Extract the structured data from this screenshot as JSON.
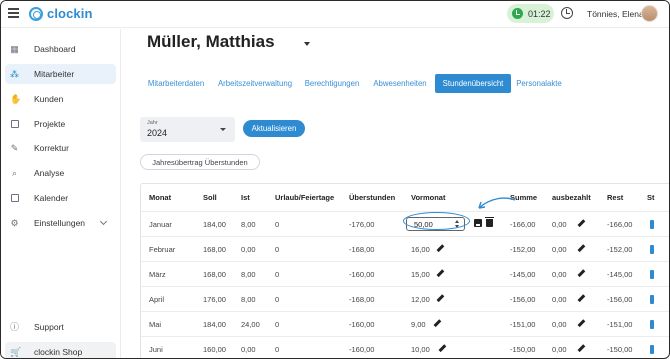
{
  "topbar": {
    "app_name": "clockin",
    "timer": "01:22",
    "user_name": "Tönnies, Elena"
  },
  "sidebar": {
    "items": [
      {
        "label": "Dashboard",
        "icon": "dashboard-icon"
      },
      {
        "label": "Mitarbeiter",
        "icon": "employees-icon",
        "active": true
      },
      {
        "label": "Kunden",
        "icon": "handshake-icon"
      },
      {
        "label": "Projekte",
        "icon": "projects-icon"
      },
      {
        "label": "Korrektur",
        "icon": "correction-icon"
      },
      {
        "label": "Analyse",
        "icon": "analysis-icon"
      },
      {
        "label": "Kalender",
        "icon": "calendar-icon"
      },
      {
        "label": "Einstellungen",
        "icon": "gear-icon"
      }
    ],
    "support_label": "Support",
    "shop_label": "clockin Shop"
  },
  "main": {
    "title": "Müller, Matthias",
    "tabs": [
      {
        "label": "Mitarbeiterdaten"
      },
      {
        "label": "Arbeitszeitverwaltung"
      },
      {
        "label": "Berechtigungen"
      },
      {
        "label": "Abwesenheiten"
      },
      {
        "label": "Stundenübersicht",
        "active": true
      },
      {
        "label": "Personalakte"
      }
    ],
    "year_label": "Jahr",
    "year_value": "2024",
    "refresh_button": "Aktualisieren",
    "carryover_button": "Jahresübertrag Überstunden"
  },
  "table": {
    "headers": [
      "Monat",
      "Soll",
      "Ist",
      "Urlaub/Feiertage",
      "Überstunden",
      "Vormonat",
      "Summe",
      "ausbezahlt",
      "Rest",
      "St"
    ],
    "rows": [
      {
        "month": "Januar",
        "soll": "184,00",
        "ist": "8,00",
        "urlaub": "0",
        "ueberstunden": "-176,00",
        "vormonat": "50,00",
        "summe": "-166,00",
        "ausbezahlt": "0,00",
        "rest": "-166,00",
        "editing": true
      },
      {
        "month": "Februar",
        "soll": "168,00",
        "ist": "0,00",
        "urlaub": "0",
        "ueberstunden": "-168,00",
        "vormonat": "16,00",
        "summe": "-152,00",
        "ausbezahlt": "0,00",
        "rest": "-152,00"
      },
      {
        "month": "März",
        "soll": "168,00",
        "ist": "8,00",
        "urlaub": "0",
        "ueberstunden": "-160,00",
        "vormonat": "15,00",
        "summe": "-145,00",
        "ausbezahlt": "0,00",
        "rest": "-145,00"
      },
      {
        "month": "April",
        "soll": "176,00",
        "ist": "8,00",
        "urlaub": "0",
        "ueberstunden": "-168,00",
        "vormonat": "12,00",
        "summe": "-156,00",
        "ausbezahlt": "0,00",
        "rest": "-156,00"
      },
      {
        "month": "Mai",
        "soll": "184,00",
        "ist": "24,00",
        "urlaub": "0",
        "ueberstunden": "-160,00",
        "vormonat": "9,00",
        "summe": "-151,00",
        "ausbezahlt": "0,00",
        "rest": "-151,00"
      },
      {
        "month": "Juni",
        "soll": "160,00",
        "ist": "0,00",
        "urlaub": "0",
        "ueberstunden": "-160,00",
        "vormonat": "10,00",
        "summe": "-150,00",
        "ausbezahlt": "0,00",
        "rest": "-150,00"
      }
    ]
  },
  "colors": {
    "accent": "#2e8bd1",
    "timer_bg": "#d7f2d7",
    "timer_dot": "#2fa84f",
    "active_nav_bg": "#e9f2fb"
  }
}
